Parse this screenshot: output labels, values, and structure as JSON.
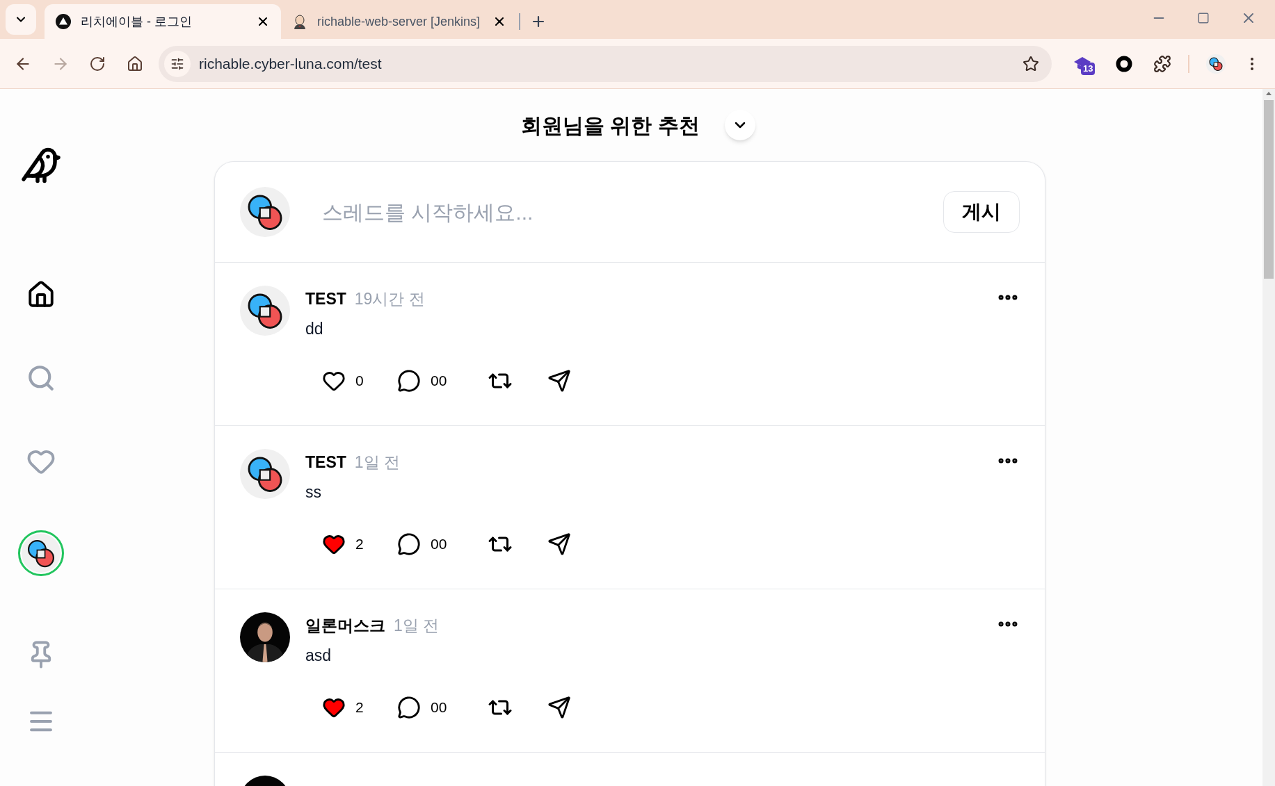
{
  "browser": {
    "tabs": [
      {
        "title": "리치에이블 - 로그인",
        "kind": "triangle",
        "selected": true
      },
      {
        "title": "richable-web-server [Jenkins]",
        "kind": "person",
        "selected": false
      }
    ],
    "url": "richable.cyber-luna.com/test",
    "extension_badge": "13"
  },
  "sidebar": {
    "items": [
      {
        "kind": "home",
        "selected": true
      },
      {
        "kind": "search",
        "selected": false
      },
      {
        "kind": "heart",
        "selected": false
      },
      {
        "kind": "profile",
        "selected": false
      }
    ]
  },
  "feed": {
    "title": "회원님을 위한 추천",
    "composer": {
      "placeholder": "스레드를 시작하세요...",
      "button": "게시"
    },
    "posts": [
      {
        "kind": "logo",
        "author": "TEST",
        "time": "19시간 전",
        "text": "dd",
        "likes": "0",
        "liked": false,
        "comments": "00"
      },
      {
        "kind": "logo",
        "author": "TEST",
        "time": "1일 전",
        "text": "ss",
        "likes": "2",
        "liked": true,
        "comments": "00"
      },
      {
        "kind": "picture",
        "author": "일론머스크",
        "time": "1일 전",
        "text": "asd",
        "likes": "2",
        "liked": true,
        "comments": "00"
      },
      {
        "kind": "picture"
      }
    ]
  }
}
